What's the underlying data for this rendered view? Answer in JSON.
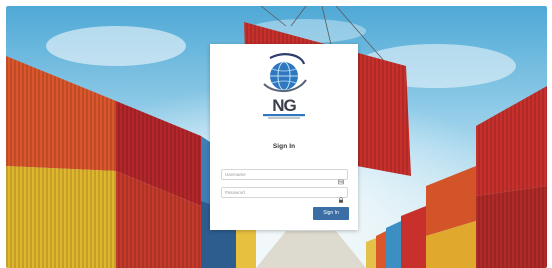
{
  "login": {
    "title": "Sign In",
    "username_placeholder": "Username",
    "username_value": "",
    "password_placeholder": "Password",
    "password_value": "",
    "submit_label": "Sign In"
  },
  "logo": {
    "text": "NG"
  },
  "icons": {
    "username": "id-card-icon",
    "password": "lock-icon"
  },
  "colors": {
    "button": "#3a6ea5",
    "card": "#ffffff"
  }
}
